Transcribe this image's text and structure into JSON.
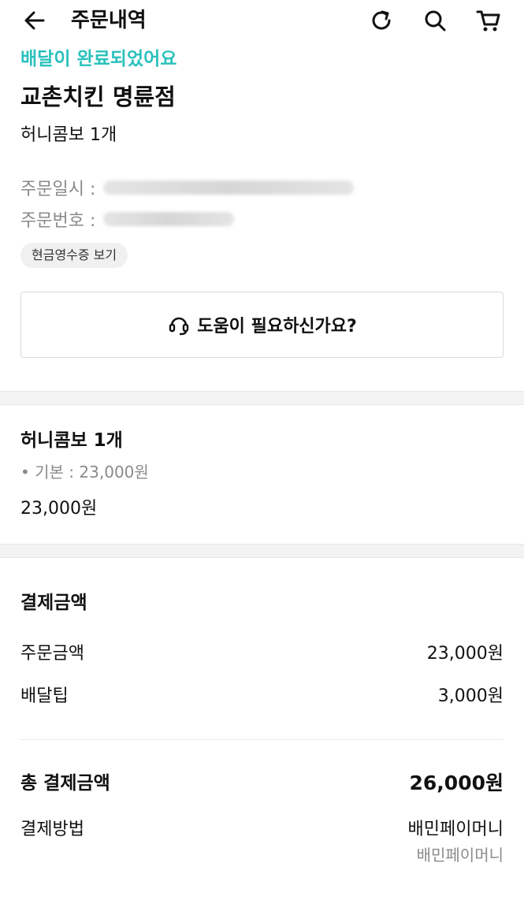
{
  "header": {
    "title": "주문내역",
    "icons": {
      "back": "arrow-left-icon",
      "refresh": "refresh-icon",
      "search": "search-icon",
      "cart": "cart-icon"
    }
  },
  "order": {
    "status": "배달이 완료되었어요",
    "store": "교촌치킨 명륜점",
    "summary": "허니콤보 1개",
    "date_label": "주문일시 :",
    "number_label": "주문번호 :",
    "receipt_button": "현금영수증 보기",
    "help_button": "도움이 필요하신가요?"
  },
  "item": {
    "name": "허니콤보 1개",
    "option": "• 기본 : 23,000원",
    "price": "23,000원"
  },
  "payment": {
    "title": "결제금액",
    "order_amount_label": "주문금액",
    "order_amount": "23,000원",
    "delivery_tip_label": "배달팁",
    "delivery_tip": "3,000원",
    "total_label": "총 결제금액",
    "total": "26,000원",
    "method_label": "결제방법",
    "method": "배민페이머니",
    "method_sub": "배민페이머니"
  },
  "colors": {
    "accent": "#2ac1bc"
  }
}
